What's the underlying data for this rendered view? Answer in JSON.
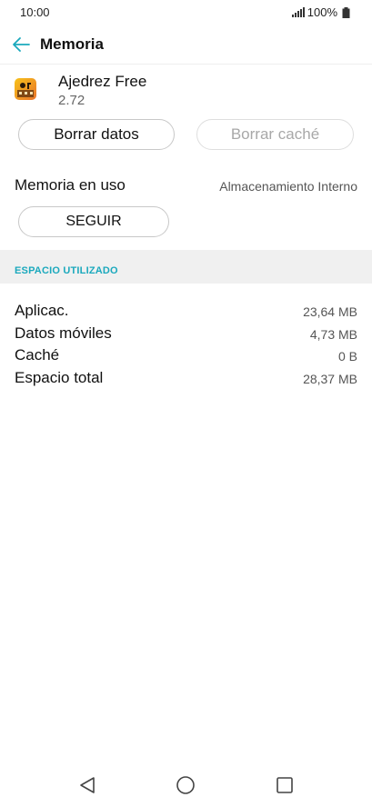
{
  "status_bar": {
    "time": "10:00",
    "battery_percent": "100%",
    "icons": [
      "signal-icon",
      "battery-icon"
    ]
  },
  "header": {
    "title": "Memoria",
    "back_icon": "back-arrow-icon"
  },
  "app": {
    "name": "Ajedrez Free",
    "version": "2.72",
    "icon": "chess-app-icon"
  },
  "buttons": {
    "clear_data": "Borrar datos",
    "clear_cache": "Borrar caché"
  },
  "memory": {
    "label": "Memoria en uso",
    "value": "Almacenamiento Interno",
    "follow_button": "SEGUIR"
  },
  "section": {
    "title": "ESPACIO UTILIZADO"
  },
  "usage": [
    {
      "label": "Aplicac.",
      "value": "23,64 MB"
    },
    {
      "label": "Datos móviles",
      "value": "4,73 MB"
    },
    {
      "label": "Caché",
      "value": "0 B"
    },
    {
      "label": "Espacio total",
      "value": "28,37 MB"
    }
  ],
  "nav_bar": {
    "icons": [
      "back-triangle-icon",
      "home-circle-icon",
      "recents-square-icon"
    ]
  },
  "colors": {
    "accent": "#1ba9bd",
    "section_bg": "#f0f0f0",
    "disabled_text": "#a8a8a8"
  }
}
